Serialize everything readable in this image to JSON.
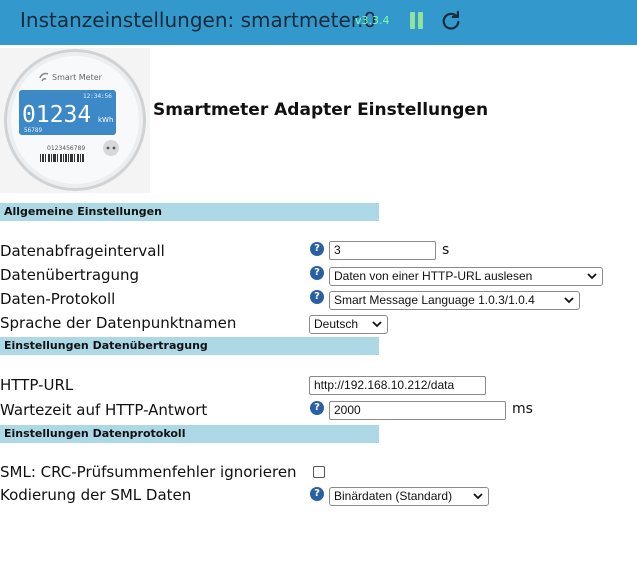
{
  "header": {
    "title": "Instanzeinstellungen: smartmeter.0",
    "version": "v3.3.4",
    "pause_icon": "pause-icon",
    "reload_icon": "reload-icon"
  },
  "logo": {
    "brand": "Smart Meter",
    "time": "12:34:56",
    "reading": "01234",
    "unit": "kWh",
    "subnumber": "56789",
    "serial": "0123456789"
  },
  "page_heading": "Smartmeter Adapter Einstellungen",
  "sections": {
    "general": "Allgemeine Einstellungen",
    "transfer": "Einstellungen Datenübertragung",
    "protocol": "Einstellungen Datenprotokoll"
  },
  "fields": {
    "interval": {
      "label": "Datenabfrageintervall",
      "value": "3",
      "unit": "s"
    },
    "transfer": {
      "label": "Datenübertragung",
      "value": "Daten von einer HTTP-URL auslesen"
    },
    "protocol": {
      "label": "Daten-Protokoll",
      "value": "Smart Message Language 1.0.3/1.0.4"
    },
    "language": {
      "label": "Sprache der Datenpunktnamen",
      "value": "Deutsch"
    },
    "http_url": {
      "label": "HTTP-URL",
      "value": "http://192.168.10.212/data"
    },
    "wait": {
      "label": "Wartezeit auf HTTP-Antwort",
      "value": "2000",
      "unit": "ms"
    },
    "crc": {
      "label": "SML: CRC-Prüfsummenfehler ignorieren",
      "checked": false
    },
    "encoding": {
      "label": "Kodierung der SML Daten",
      "value": "Binärdaten (Standard)"
    }
  },
  "help_glyph": "?",
  "colors": {
    "header": "#3399cc",
    "section": "#add8e6",
    "help": "#2a5fa0",
    "version": "#7fffa6"
  }
}
